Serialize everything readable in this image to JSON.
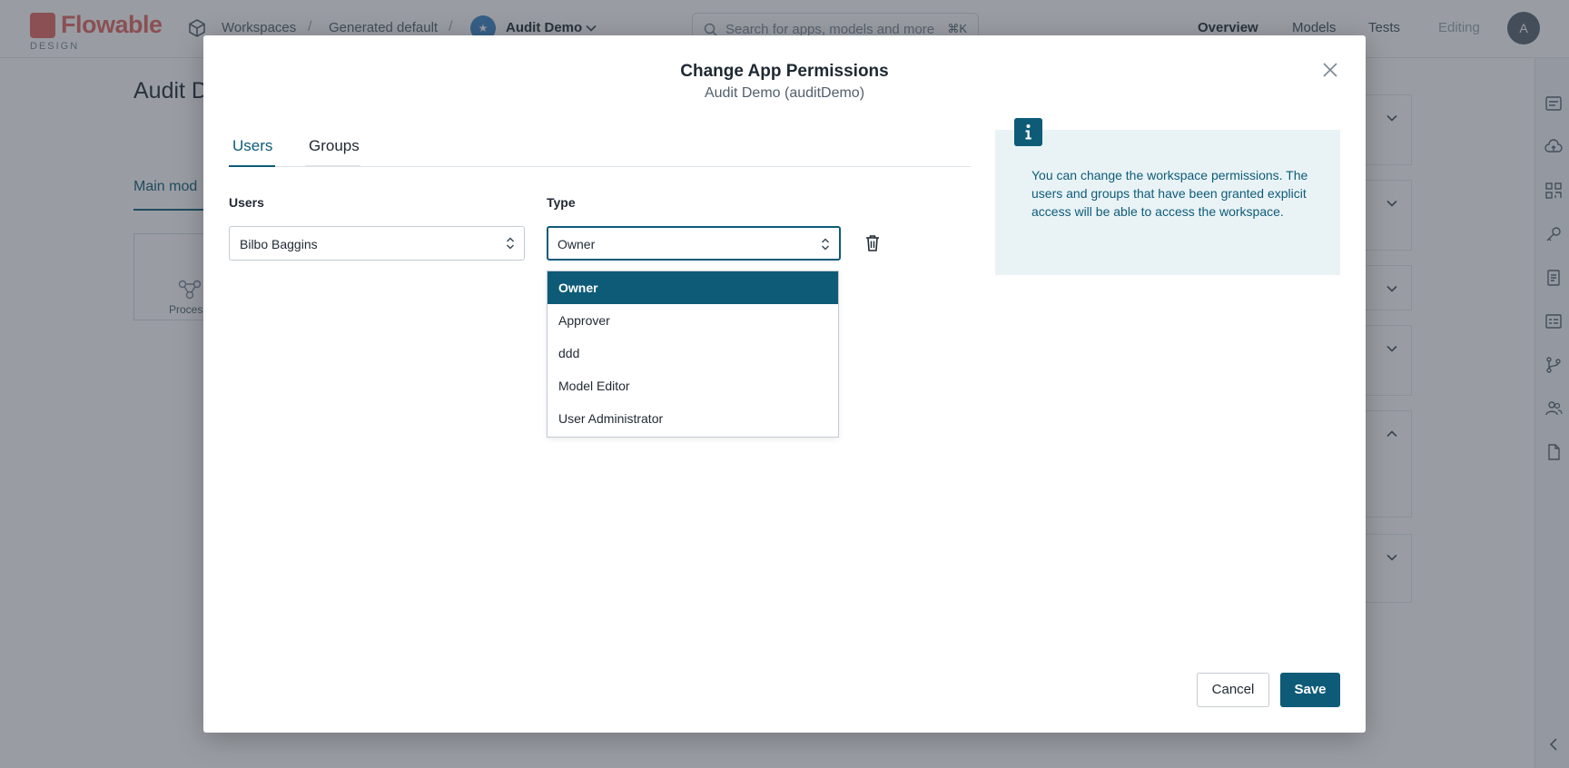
{
  "app": {
    "logo_text": "Flowable",
    "logo_sub": "DESIGN",
    "breadcrumbs": [
      "Workspaces",
      "Generated default"
    ],
    "current_app": "Audit Demo",
    "app_avatar_letter": "★",
    "search_placeholder": "Search for apps, models and more",
    "search_shortcut": "⌘K",
    "nav": [
      "Overview",
      "Models",
      "Tests",
      "Editing"
    ],
    "user_initial": "A",
    "page_title": "Audit D",
    "page_tab": "Main mod",
    "card_label": "Proces"
  },
  "modal": {
    "title": "Change App Permissions",
    "subtitle": "Audit Demo (auditDemo)",
    "tabs": [
      "Users",
      "Groups"
    ],
    "active_tab": "Users",
    "users_label": "Users",
    "type_label": "Type",
    "selected_user": "Bilbo Baggins",
    "selected_type": "Owner",
    "type_options": [
      "Owner",
      "Approver",
      "ddd",
      "Model Editor",
      "User Administrator"
    ],
    "info_text": "You can change the workspace permissions. The users and groups that have been granted explicit access will be able to access the workspace.",
    "cancel_label": "Cancel",
    "save_label": "Save"
  },
  "colors": {
    "accent": "#0e5b78",
    "brand": "#e0655e",
    "info_bg": "#e9f3f6"
  }
}
